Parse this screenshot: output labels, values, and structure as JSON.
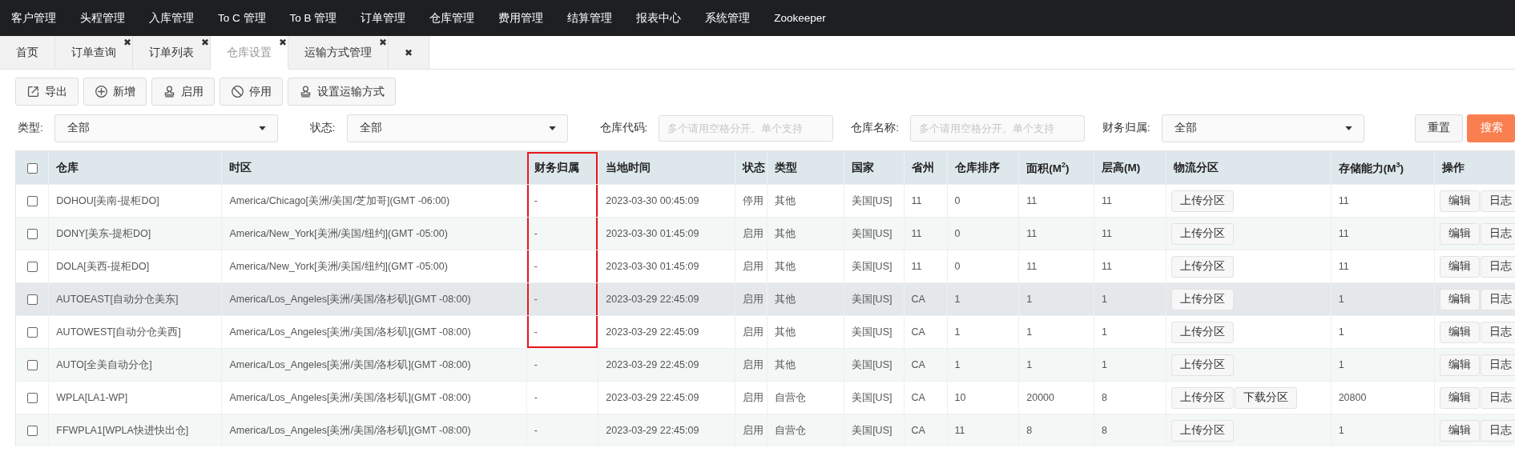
{
  "nav": {
    "items": [
      "客户管理",
      "头程管理",
      "入库管理",
      "To C 管理",
      "To B 管理",
      "订单管理",
      "仓库管理",
      "费用管理",
      "结算管理",
      "报表中心",
      "系统管理",
      "Zookeeper"
    ]
  },
  "tabs": [
    {
      "label": "首页",
      "selected": false
    },
    {
      "label": "订单查询",
      "close": "✖",
      "selected": false
    },
    {
      "label": "订单列表",
      "close": "✖",
      "selected": false
    },
    {
      "label": "仓库设置",
      "close": "✖",
      "selected": true
    },
    {
      "label": "运输方式管理",
      "close": "✖",
      "selected": false
    },
    {
      "close": "✖",
      "selected": false
    }
  ],
  "toolbar": [
    {
      "label": "导出",
      "kind": "export"
    },
    {
      "label": "新增",
      "kind": "add"
    },
    {
      "label": "启用",
      "kind": "stamp"
    },
    {
      "label": "停用",
      "kind": "ban"
    },
    {
      "label": "设置运输方式",
      "kind": "stamp"
    }
  ],
  "filters": [
    {
      "label": "类型:",
      "kind": "select",
      "value": "全部"
    },
    {
      "label": "状态:",
      "kind": "select",
      "value": "全部"
    },
    {
      "label": "仓库代码:",
      "kind": "input",
      "placeholder": "多个请用空格分开。单个支持"
    },
    {
      "label": "仓库名称:",
      "kind": "input",
      "placeholder": "多个请用空格分开。单个支持"
    },
    {
      "label": "财务归属:",
      "kind": "select",
      "value": "全部"
    }
  ],
  "filter_buttons": [
    {
      "label": "重置",
      "kind": "plain"
    },
    {
      "label": "搜索",
      "kind": "primary"
    }
  ],
  "table": {
    "all_checked": false,
    "columns": [
      {
        "label": "仓库",
        "kind": "text",
        "marked": false
      },
      {
        "label": "时区",
        "kind": "text",
        "marked": false
      },
      {
        "label": "财务归属",
        "kind": "text",
        "marked": true
      },
      {
        "label": "当地时间",
        "kind": "text",
        "marked": false
      },
      {
        "label": "状态",
        "kind": "text",
        "marked": false
      },
      {
        "label": "类型",
        "kind": "text",
        "marked": false
      },
      {
        "label": "国家",
        "kind": "text",
        "marked": false
      },
      {
        "label": "省州",
        "kind": "text",
        "marked": false
      },
      {
        "label": "仓库排序",
        "kind": "text",
        "marked": false
      },
      {
        "label": "面积(M$^{2}$)",
        "kind": "text",
        "marked": false
      },
      {
        "label": "层高(M)",
        "kind": "text",
        "marked": false
      },
      {
        "label": "物流分区",
        "kind": "zones",
        "marked": false
      },
      {
        "label": "存储能力(M$^{3}$)",
        "kind": "text",
        "marked": false
      },
      {
        "label": "操作",
        "kind": "actions",
        "marked": false
      }
    ],
    "rows": [
      {
        "checked": false,
        "hovered": false,
        "marked": true,
        "cells": [
          "DOHOU[美南-提柜DO]",
          "America/Chicago[美洲/美国/芝加哥](GMT -06:00)",
          "-",
          "2023-03-30 00:45:09",
          "停用",
          "其他",
          "美国[US]",
          "11",
          "0",
          "11",
          "11",
          "11"
        ],
        "zones": [
          "上传分区"
        ],
        "actions": [
          "编辑",
          "日志"
        ]
      },
      {
        "checked": false,
        "hovered": false,
        "marked": true,
        "cells": [
          "DONY[美东-提柜DO]",
          "America/New_York[美洲/美国/纽约](GMT -05:00)",
          "-",
          "2023-03-30 01:45:09",
          "启用",
          "其他",
          "美国[US]",
          "11",
          "0",
          "11",
          "11",
          "11"
        ],
        "zones": [
          "上传分区"
        ],
        "actions": [
          "编辑",
          "日志"
        ]
      },
      {
        "checked": false,
        "hovered": false,
        "marked": true,
        "cells": [
          "DOLA[美西-提柜DO]",
          "America/New_York[美洲/美国/纽约](GMT -05:00)",
          "-",
          "2023-03-30 01:45:09",
          "启用",
          "其他",
          "美国[US]",
          "11",
          "0",
          "11",
          "11",
          "11"
        ],
        "zones": [
          "上传分区"
        ],
        "actions": [
          "编辑",
          "日志"
        ]
      },
      {
        "checked": false,
        "hovered": true,
        "marked": true,
        "cells": [
          "AUTOEAST[自动分仓美东]",
          "America/Los_Angeles[美洲/美国/洛杉矶](GMT -08:00)",
          "-",
          "2023-03-29 22:45:09",
          "启用",
          "其他",
          "美国[US]",
          "CA",
          "1",
          "1",
          "1",
          "1"
        ],
        "zones": [
          "上传分区"
        ],
        "actions": [
          "编辑",
          "日志"
        ]
      },
      {
        "checked": false,
        "hovered": false,
        "marked": true,
        "cells": [
          "AUTOWEST[自动分仓美西]",
          "America/Los_Angeles[美洲/美国/洛杉矶](GMT -08:00)",
          "-",
          "2023-03-29 22:45:09",
          "启用",
          "其他",
          "美国[US]",
          "CA",
          "1",
          "1",
          "1",
          "1"
        ],
        "zones": [
          "上传分区"
        ],
        "actions": [
          "编辑",
          "日志"
        ]
      },
      {
        "checked": false,
        "hovered": false,
        "marked": false,
        "cells": [
          "AUTO[全美自动分仓]",
          "America/Los_Angeles[美洲/美国/洛杉矶](GMT -08:00)",
          "-",
          "2023-03-29 22:45:09",
          "启用",
          "其他",
          "美国[US]",
          "CA",
          "1",
          "1",
          "1",
          "1"
        ],
        "zones": [
          "上传分区"
        ],
        "actions": [
          "编辑",
          "日志"
        ]
      },
      {
        "checked": false,
        "hovered": false,
        "marked": false,
        "cells": [
          "WPLA[LA1-WP]",
          "America/Los_Angeles[美洲/美国/洛杉矶](GMT -08:00)",
          "-",
          "2023-03-29 22:45:09",
          "启用",
          "自营仓",
          "美国[US]",
          "CA",
          "10",
          "20000",
          "8",
          "20800"
        ],
        "zones": [
          "上传分区",
          "下载分区"
        ],
        "actions": [
          "编辑",
          "日志"
        ]
      },
      {
        "checked": false,
        "hovered": false,
        "marked": false,
        "cells": [
          "FFWPLA1[WPLA快进快出仓]",
          "America/Los_Angeles[美洲/美国/洛杉矶](GMT -08:00)",
          "-",
          "2023-03-29 22:45:09",
          "启用",
          "自营仓",
          "美国[US]",
          "CA",
          "11",
          "8",
          "8",
          "1"
        ],
        "zones": [
          "上传分区"
        ],
        "actions": [
          "编辑",
          "日志"
        ]
      }
    ]
  }
}
